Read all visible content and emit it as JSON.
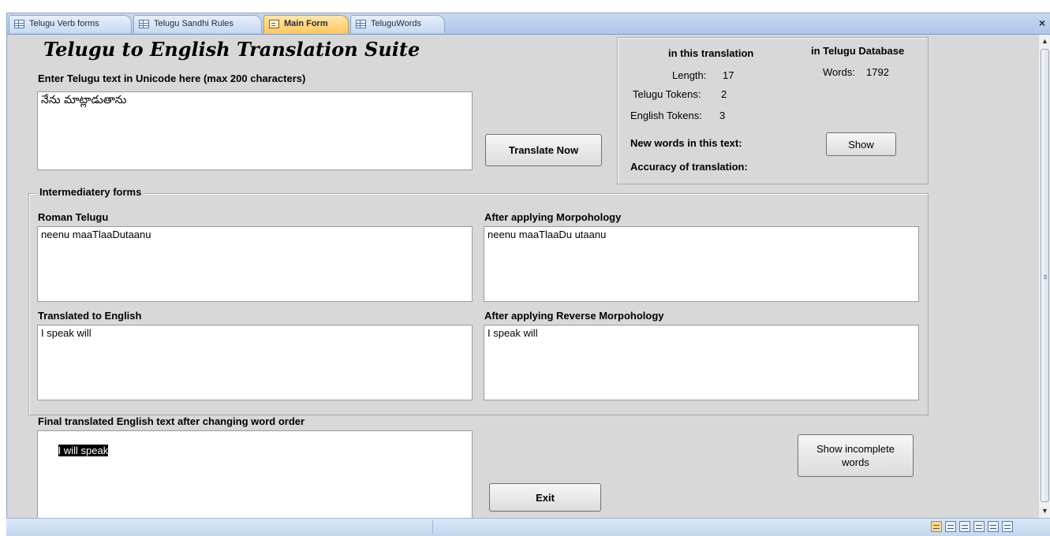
{
  "tabs": [
    {
      "label": "Telugu Verb forms",
      "icon": "table-icon",
      "active": false
    },
    {
      "label": "Telugu Sandhi Rules",
      "icon": "table-icon",
      "active": false
    },
    {
      "label": "Main Form",
      "icon": "form-icon",
      "active": true
    },
    {
      "label": "TeluguWords",
      "icon": "table-icon",
      "active": false
    }
  ],
  "close_glyph": "×",
  "form": {
    "title": "Telugu to English Translation Suite",
    "input_label": "Enter Telugu text in Unicode here (max 200 characters)",
    "input_value": "నేను మాట్లాడుతాను",
    "translate_button": "Translate Now",
    "stats": {
      "this_translation_header": "in this translation",
      "database_header": "in Telugu Database",
      "length_label": "Length:",
      "length_value": "17",
      "telugu_tokens_label": "Telugu Tokens:",
      "telugu_tokens_value": "2",
      "english_tokens_label": "English Tokens:",
      "english_tokens_value": "3",
      "words_label": "Words:",
      "words_value": "1792",
      "new_words_label": "New words in this text:",
      "show_button": "Show",
      "accuracy_label": "Accuracy of translation:"
    },
    "intermediate": {
      "legend": "Intermediatery forms",
      "roman_label": "Roman Telugu",
      "roman_value": "neenu maaTlaaDutaanu",
      "morph_label": "After applying Morpohology",
      "morph_value": "neenu maaTlaaDu utaanu",
      "translated_label": "Translated to English",
      "translated_value": "I speak will",
      "reverse_label": "After applying Reverse Morpohology",
      "reverse_value": "I speak will"
    },
    "final_label": "Final translated English text after changing word order",
    "final_value": "I will speak",
    "show_incomplete_button": "Show incomplete words",
    "exit_button": "Exit"
  },
  "colors": {
    "form_background": "#d8d8d8",
    "active_tab": "#ffc85c",
    "tab_bar": "#c9daf2"
  }
}
